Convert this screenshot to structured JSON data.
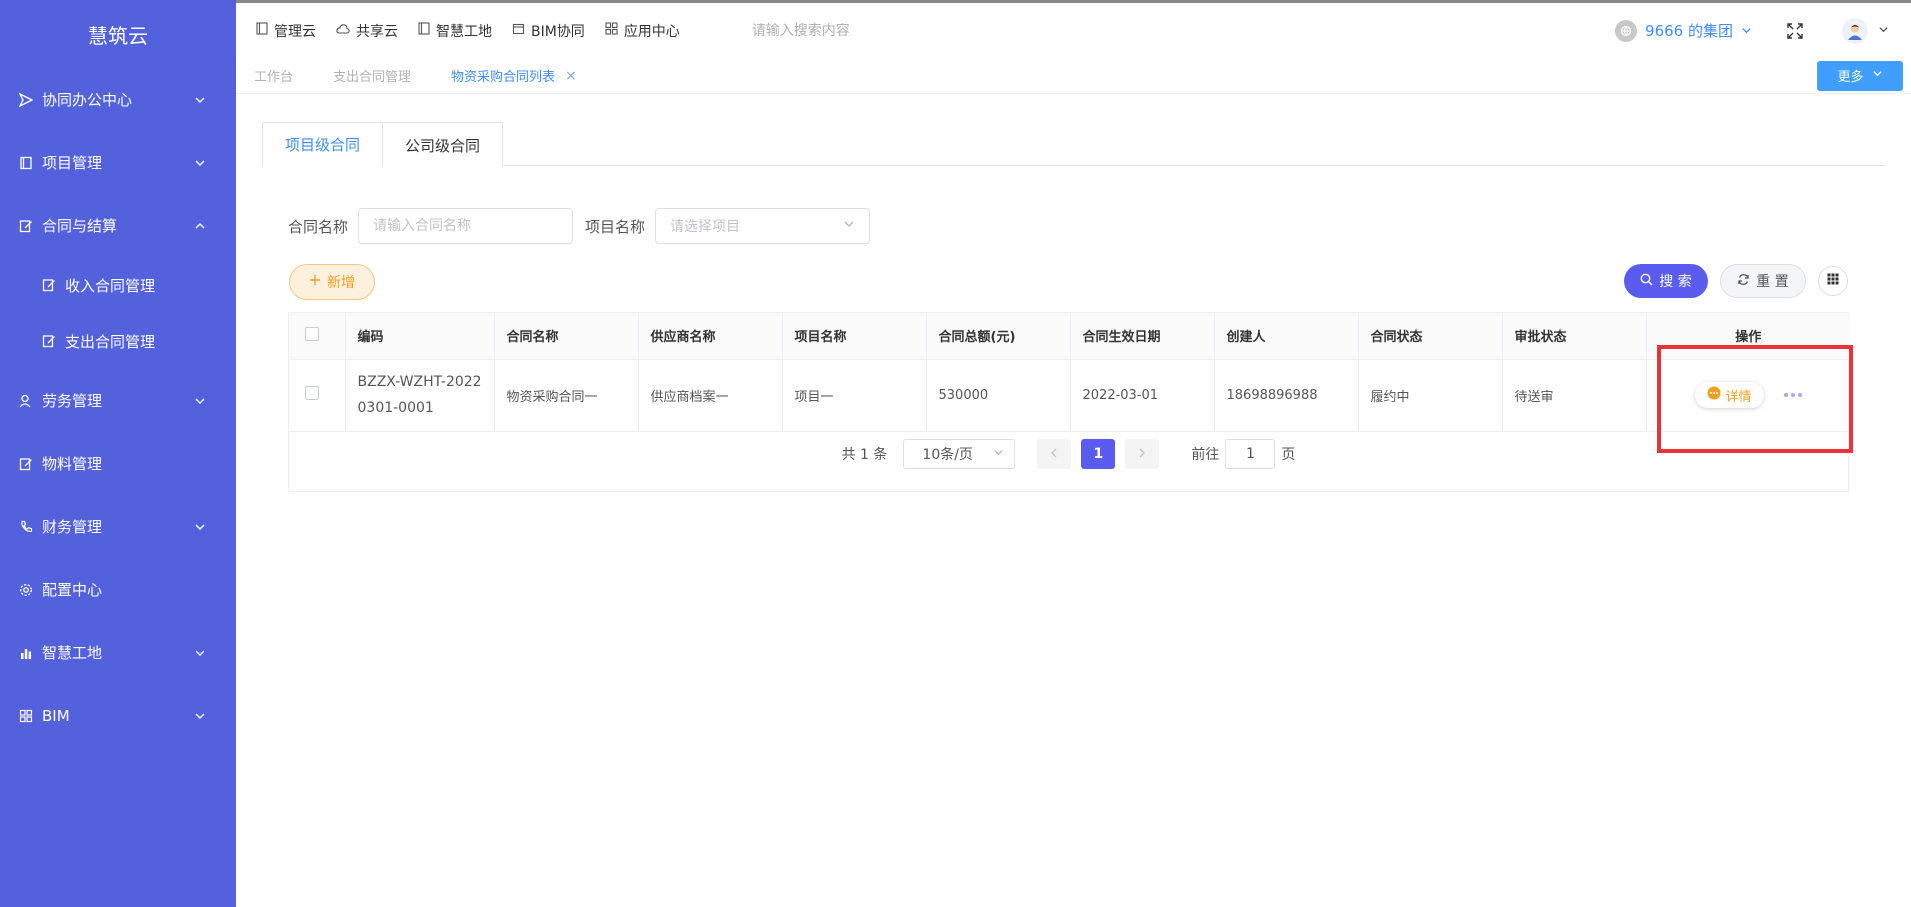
{
  "sidebar": {
    "logo": "慧筑云",
    "items": [
      {
        "label": "协同办公中心",
        "icon": "send-icon",
        "expanded": false
      },
      {
        "label": "项目管理",
        "icon": "book-icon",
        "expanded": false
      },
      {
        "label": "合同与结算",
        "icon": "edit-icon",
        "expanded": true
      },
      {
        "label": "收入合同管理",
        "icon": "edit-icon",
        "sub": true
      },
      {
        "label": "支出合同管理",
        "icon": "edit-icon",
        "sub": true
      },
      {
        "label": "劳务管理",
        "icon": "worker-icon",
        "expanded": false
      },
      {
        "label": "物料管理",
        "icon": "edit-icon"
      },
      {
        "label": "财务管理",
        "icon": "phone-icon",
        "expanded": false
      },
      {
        "label": "配置中心",
        "icon": "gear-icon"
      },
      {
        "label": "智慧工地",
        "icon": "bar-chart-icon",
        "expanded": false
      },
      {
        "label": "BIM",
        "icon": "grid-icon",
        "expanded": false
      }
    ]
  },
  "topbar": {
    "nav": [
      {
        "label": "管理云",
        "icon": "book-icon"
      },
      {
        "label": "共享云",
        "icon": "cloud-icon"
      },
      {
        "label": "智慧工地",
        "icon": "book-icon"
      },
      {
        "label": "BIM协同",
        "icon": "cube-icon"
      },
      {
        "label": "应用中心",
        "icon": "apps-icon"
      }
    ],
    "search_placeholder": "请输入搜索内容",
    "group": "9666 的集团"
  },
  "tabstrip": {
    "tabs": [
      "工作台",
      "支出合同管理",
      "物资采购合同列表"
    ],
    "close_symbol": "×",
    "more_label": "更多"
  },
  "content": {
    "tabs": [
      "项目级合同",
      "公司级合同"
    ],
    "filters": {
      "contract_name_label": "合同名称",
      "contract_name_placeholder": "请输入合同名称",
      "project_name_label": "项目名称",
      "project_name_placeholder": "请选择项目"
    },
    "buttons": {
      "add": "新增",
      "search": "搜 索",
      "reset": "重 置"
    },
    "table": {
      "columns": [
        "编码",
        "合同名称",
        "供应商名称",
        "项目名称",
        "合同总额(元)",
        "合同生效日期",
        "创建人",
        "合同状态",
        "审批状态",
        "操作"
      ],
      "rows": [
        {
          "code_line1": "BZZX-WZHT-2022",
          "code_line2": "0301-0001",
          "contract_name": "物资采购合同一",
          "supplier": "供应商档案一",
          "project": "项目一",
          "amount": "530000",
          "effective_date": "2022-03-01",
          "creator": "18698896988",
          "contract_status": "履约中",
          "approval_status": "待送审",
          "detail_label": "详情"
        }
      ]
    },
    "pagination": {
      "total": "共 1 条",
      "page_size": "10条/页",
      "current_page": "1",
      "goto_label": "前往",
      "goto_value": "1",
      "page_unit": "页"
    }
  },
  "colors": {
    "sidebar_bg": "#5461dc",
    "accent_blue": "#3f8ef5",
    "primary_purple": "#5a5cf0",
    "warning_orange": "#f0a020",
    "highlight_red": "#e8333b"
  }
}
